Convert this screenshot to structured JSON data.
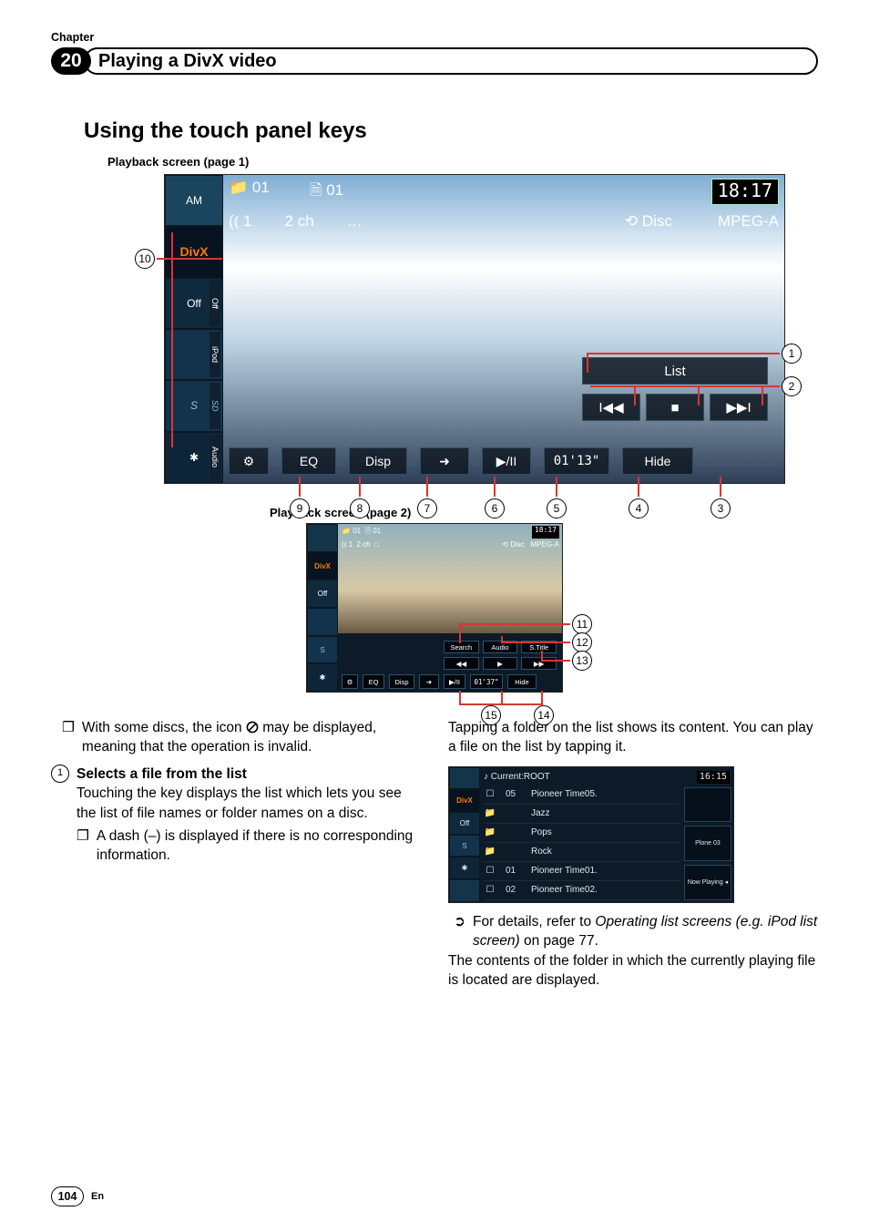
{
  "header": {
    "chapter_label": "Chapter",
    "chapter_num": "20",
    "title": "Playing a DivX video"
  },
  "section_title": "Using the touch panel keys",
  "caption1": "Playback screen (page 1)",
  "caption2": "Playback screen (page 2)",
  "pb1": {
    "tabs": {
      "am": "AM",
      "divx": "DivX",
      "off": "Off",
      "ipod": "",
      "sd": "S",
      "bt": "✱",
      "rot_off": "Off",
      "rot_ipod": "iPod",
      "rot_sd": "SD",
      "rot_audio": "Audio"
    },
    "folder": "01",
    "file": "01",
    "clock": "18:17",
    "audio": "1",
    "ch": "2 ch",
    "sub": "…",
    "loop": "⟲ Disc",
    "codec": "MPEG-A",
    "list": "List",
    "prev": "I◀◀",
    "stop": "■",
    "next": "▶▶I",
    "gear": "⚙",
    "eq": "EQ",
    "disp": "Disp",
    "arrow": "➜",
    "play": "▶/II",
    "time": "01'13\"",
    "hide": "Hide"
  },
  "pb2": {
    "folder": "01",
    "file": "01",
    "clock": "18:17",
    "audio": "1",
    "ch": "2 ch",
    "sub": "□",
    "loop": "⟲ Disc",
    "codec": "MPEG-A",
    "search": "Search",
    "audio_btn": "Audio",
    "stitle": "S.Title",
    "rew": "◀◀",
    "adv": "▶",
    "ffw": "▶▶",
    "gear": "⚙",
    "eq": "EQ",
    "disp": "Disp",
    "arrow": "➜",
    "play": "▶/II",
    "time": "01'37\"",
    "hide": "Hide"
  },
  "callouts1": {
    "c10": "10",
    "c1": "1",
    "c2": "2",
    "c3": "3",
    "c4": "4",
    "c5": "5",
    "c6": "6",
    "c7": "7",
    "c8": "8",
    "c9": "9"
  },
  "callouts2": {
    "c11": "11",
    "c12": "12",
    "c13": "13",
    "c14": "14",
    "c15": "15"
  },
  "note1_a": "With some discs, the icon ",
  "note1_b": " may be displayed, meaning that the operation is invalid.",
  "item1": {
    "num": "1",
    "lead": "Selects a file from the list",
    "body": "Touching the key displays the list which lets you see the list of file names or folder names on a disc.",
    "sub": "A dash (–) is displayed if there is no corresponding information."
  },
  "right": {
    "p1": "Tapping a folder on the list shows its content. You can play a file on the list by tapping it.",
    "ref_a": "For details, refer to ",
    "ref_i": "Operating list screens (e.g. iPod list screen)",
    "ref_b": " on page 77.",
    "p2": "The contents of the folder in which the currently playing file is located are displayed."
  },
  "listshot": {
    "hdr_title": "Current:ROOT",
    "hdr_time": "16:15",
    "rows": [
      {
        "ico": "☐",
        "num": "05",
        "name": "Pioneer Time05."
      },
      {
        "ico": "📁",
        "num": "",
        "name": "Jazz"
      },
      {
        "ico": "📁",
        "num": "",
        "name": "Pops"
      },
      {
        "ico": "📁",
        "num": "",
        "name": "Rock"
      },
      {
        "ico": "☐",
        "num": "01",
        "name": "Pioneer Time01."
      },
      {
        "ico": "☐",
        "num": "02",
        "name": "Pioneer Time02."
      }
    ],
    "side": [
      "",
      "Plone 03",
      "Now Playing ◂"
    ],
    "tabs": {
      "divx": "DivX",
      "off": "Off",
      "sd": "S",
      "bt": "✱",
      "extra": ""
    }
  },
  "footer": {
    "page": "104",
    "lang": "En"
  }
}
